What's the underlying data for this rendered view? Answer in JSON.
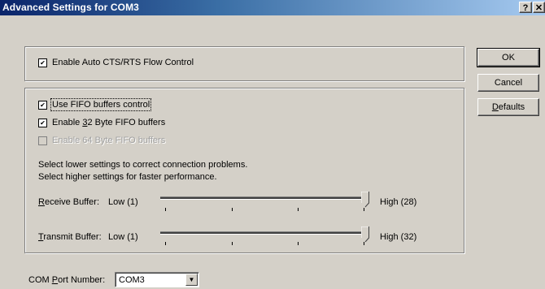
{
  "window": {
    "title": "Advanced Settings for COM3",
    "help_glyph": "?",
    "close_glyph": "✕"
  },
  "flow_control": {
    "label": "Enable Auto CTS/RTS Flow Control",
    "checked": true
  },
  "fifo": {
    "use_fifo": {
      "label": "Use FIFO buffers control",
      "checked": true
    },
    "enable_32": {
      "label_pre": "Enable ",
      "label_ul": "3",
      "label_post": "2 Byte FIFO buffers",
      "checked": true
    },
    "enable_64": {
      "label": "Enable 64 Byte FIFO buffers",
      "checked": false,
      "disabled": true
    },
    "hint_line1": "Select lower settings to correct connection problems.",
    "hint_line2": "Select higher settings for faster performance."
  },
  "receive_buffer": {
    "label_ul": "R",
    "label_rest": "eceive Buffer:",
    "low_label": "Low (1)",
    "high_label": "High (28)",
    "level": 1.0
  },
  "transmit_buffer": {
    "label_ul": "T",
    "label_rest": "ransmit Buffer:",
    "low_label": "Low (1)",
    "high_label": "High (32)",
    "level": 1.0
  },
  "com_port": {
    "label_pre": "COM ",
    "label_ul": "P",
    "label_post": "ort Number:",
    "value": "COM3"
  },
  "buttons": {
    "ok": "OK",
    "cancel": "Cancel",
    "defaults_ul": "D",
    "defaults_rest": "efaults"
  },
  "colors": {
    "title_start": "#0a246a",
    "title_end": "#a6caf0",
    "face": "#d4d0c8"
  }
}
